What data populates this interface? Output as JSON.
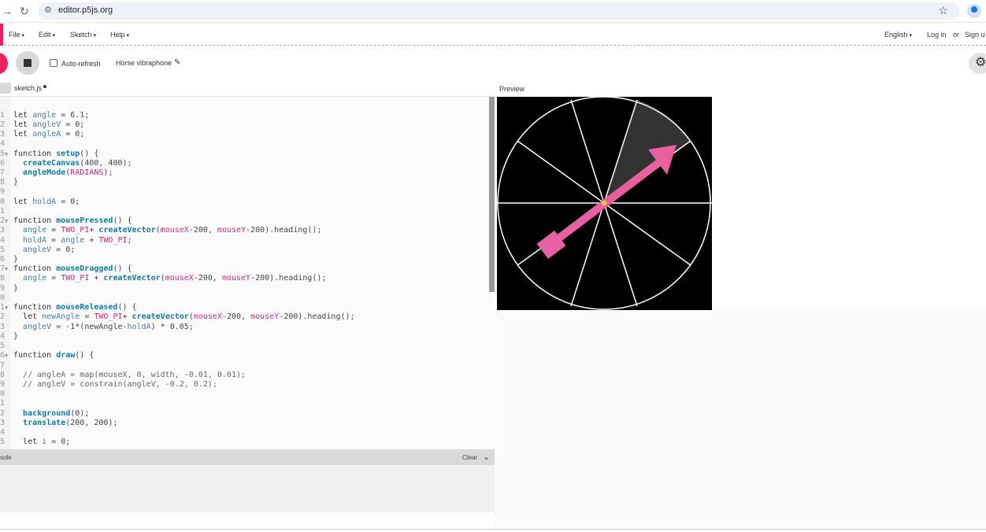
{
  "browser": {
    "url": "editor.p5js.org",
    "icons": [
      "forward-arrow-icon",
      "reload-icon",
      "site-info-icon",
      "star-icon",
      "profile-icon"
    ]
  },
  "menubar": {
    "items": [
      "File",
      "Edit",
      "Sketch",
      "Help"
    ],
    "language": "English",
    "login": "Log in",
    "or": "or",
    "signup": "Sign u"
  },
  "toolbar": {
    "auto_refresh_label": "Auto-refresh",
    "auto_refresh_checked": false,
    "sketch_name": "Horse vibraphone"
  },
  "editor": {
    "file_tab": "sketch.js",
    "unsaved": true
  },
  "console": {
    "title": "sole",
    "clear_label": "Clear"
  },
  "preview": {
    "label": "Preview"
  },
  "colors": {
    "brand": "#ed225d",
    "arrow": "#e8609f",
    "highlight_sector": "#333333"
  }
}
